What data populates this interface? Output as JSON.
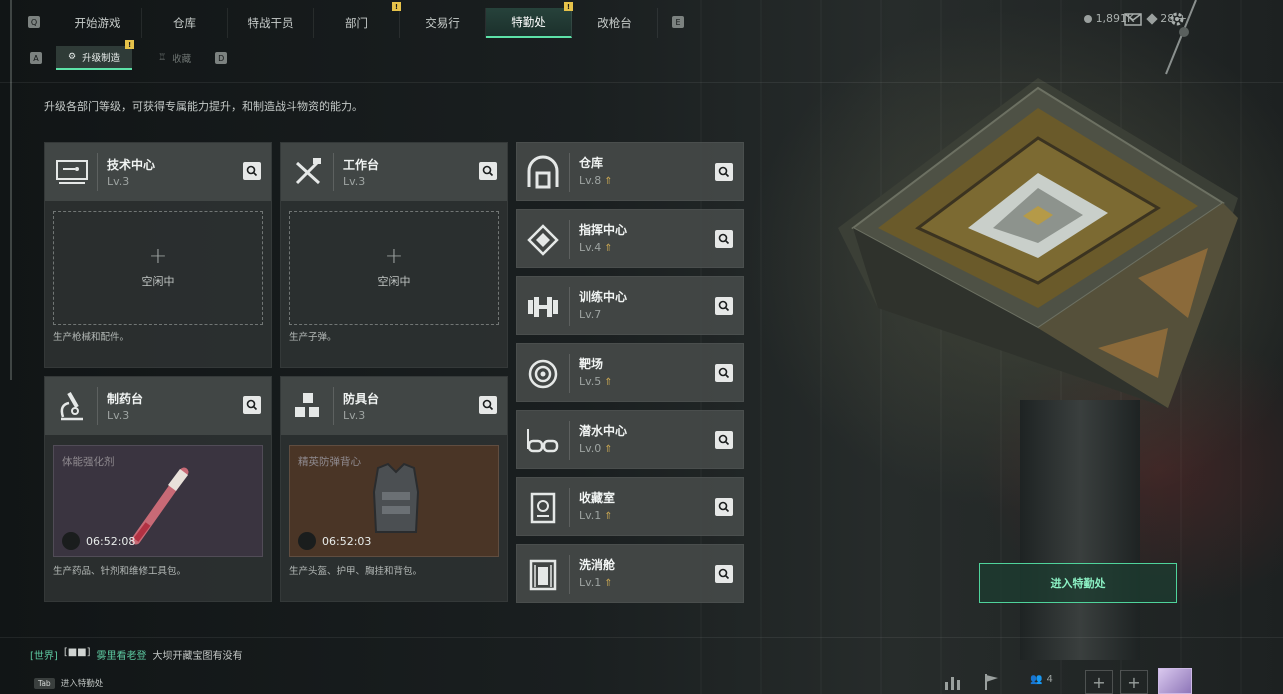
{
  "topnav": {
    "left_key": "Q",
    "right_key": "E",
    "tabs": [
      {
        "label": "开始游戏",
        "active": false,
        "badge": ""
      },
      {
        "label": "仓库",
        "active": false,
        "badge": ""
      },
      {
        "label": "特战干员",
        "active": false,
        "badge": ""
      },
      {
        "label": "部门",
        "active": false,
        "badge": "!"
      },
      {
        "label": "交易行",
        "active": false,
        "badge": ""
      },
      {
        "label": "特勤处",
        "active": true,
        "badge": "!"
      },
      {
        "label": "改枪台",
        "active": false,
        "badge": ""
      }
    ],
    "currency": "1,891K",
    "tickets": "28 +"
  },
  "subnav": {
    "left_key": "A",
    "right_key": "D",
    "tabs": [
      {
        "label": "升级制造",
        "active": true,
        "badge": "!"
      },
      {
        "label": "收藏",
        "active": false,
        "badge": ""
      }
    ]
  },
  "description": "升级各部门等级，可获得专属能力提升，和制造战斗物资的能力。",
  "production_stations": [
    {
      "name": "技术中心",
      "level": "Lv.3",
      "status": "空闲中",
      "footer": "生产枪械和配件。",
      "icon": "computer-icon"
    },
    {
      "name": "工作台",
      "level": "Lv.3",
      "status": "空闲中",
      "footer": "生产子弹。",
      "icon": "tools-icon"
    },
    {
      "name": "制药台",
      "level": "Lv.3",
      "item": "体能强化剂",
      "time": "06:52:08",
      "footer": "生产药品、针剂和维修工具包。",
      "icon": "microscope-icon",
      "bg": "#3a3440"
    },
    {
      "name": "防具台",
      "level": "Lv.3",
      "item": "精英防弹背心",
      "time": "06:52:03",
      "footer": "生产头盔、护甲、胸挂和背包。",
      "icon": "cubes-icon",
      "bg": "#4a3526"
    }
  ],
  "facilities": [
    {
      "name": "仓库",
      "level": "Lv.8",
      "icon": "arch-icon"
    },
    {
      "name": "指挥中心",
      "level": "Lv.4",
      "icon": "diamond-icon"
    },
    {
      "name": "训练中心",
      "level": "Lv.7",
      "icon": "dumbbell-icon"
    },
    {
      "name": "靶场",
      "level": "Lv.5",
      "icon": "target-icon"
    },
    {
      "name": "潜水中心",
      "level": "Lv.0",
      "icon": "goggles-icon"
    },
    {
      "name": "收藏室",
      "level": "Lv.1",
      "icon": "trophy-icon"
    },
    {
      "name": "洗消舱",
      "level": "Lv.1",
      "icon": "shower-icon"
    }
  ],
  "enter_button": "进入特勤处",
  "chat": {
    "channel": "[世界]",
    "tag": "[■■]",
    "user": "雾里看老登",
    "message": "大坝开藏宝图有没有"
  },
  "tab_hint": {
    "key": "Tab",
    "label": "进入特勤处"
  },
  "friends_count": "4",
  "colors": {
    "accent": "#5de2a8",
    "badge": "#e6c24a",
    "upgrade": "#c7a552"
  }
}
